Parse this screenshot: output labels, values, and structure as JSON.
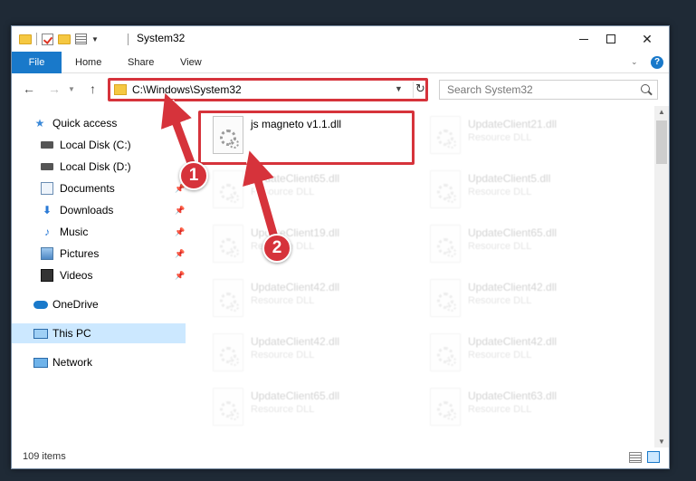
{
  "window": {
    "title": "System32"
  },
  "ribbon": {
    "tabs": [
      {
        "label": "File"
      },
      {
        "label": "Home"
      },
      {
        "label": "Share"
      },
      {
        "label": "View"
      }
    ],
    "help_label": "?"
  },
  "nav": {
    "address": "C:\\Windows\\System32",
    "search_placeholder": "Search System32"
  },
  "sidebar": {
    "items": [
      {
        "label": "Quick access",
        "icon": "star-icon"
      },
      {
        "label": "Local Disk (C:)",
        "icon": "drive-icon"
      },
      {
        "label": "Local Disk (D:)",
        "icon": "drive-icon"
      },
      {
        "label": "Documents",
        "icon": "documents-icon"
      },
      {
        "label": "Downloads",
        "icon": "download-icon"
      },
      {
        "label": "Music",
        "icon": "music-icon"
      },
      {
        "label": "Pictures",
        "icon": "pictures-icon"
      },
      {
        "label": "Videos",
        "icon": "videos-icon"
      },
      {
        "label": "OneDrive",
        "icon": "cloud-icon"
      },
      {
        "label": "This PC",
        "icon": "computer-icon"
      },
      {
        "label": "Network",
        "icon": "network-icon"
      }
    ]
  },
  "files": {
    "highlighted": {
      "name": "js magneto v1.1.dll"
    },
    "left": [
      {
        "name": "UpdateClient65.dll",
        "type": "Resource DLL"
      },
      {
        "name": "UpdateClient19.dll",
        "type": "Resource DLL"
      },
      {
        "name": "UpdateClient42.dll",
        "type": "Resource DLL"
      },
      {
        "name": "UpdateClient42.dll",
        "type": "Resource DLL"
      },
      {
        "name": "UpdateClient65.dll",
        "type": "Resource DLL"
      }
    ],
    "right": [
      {
        "name": "UpdateClient21.dll",
        "type": "Resource DLL"
      },
      {
        "name": "UpdateClient5.dll",
        "type": "Resource DLL"
      },
      {
        "name": "UpdateClient65.dll",
        "type": "Resource DLL"
      },
      {
        "name": "UpdateClient42.dll",
        "type": "Resource DLL"
      },
      {
        "name": "UpdateClient42.dll",
        "type": "Resource DLL"
      },
      {
        "name": "UpdateClient63.dll",
        "type": "Resource DLL"
      }
    ]
  },
  "status": {
    "item_count": "109 items"
  },
  "annotations": {
    "step1": "1",
    "step2": "2",
    "color": "#d6333b"
  }
}
